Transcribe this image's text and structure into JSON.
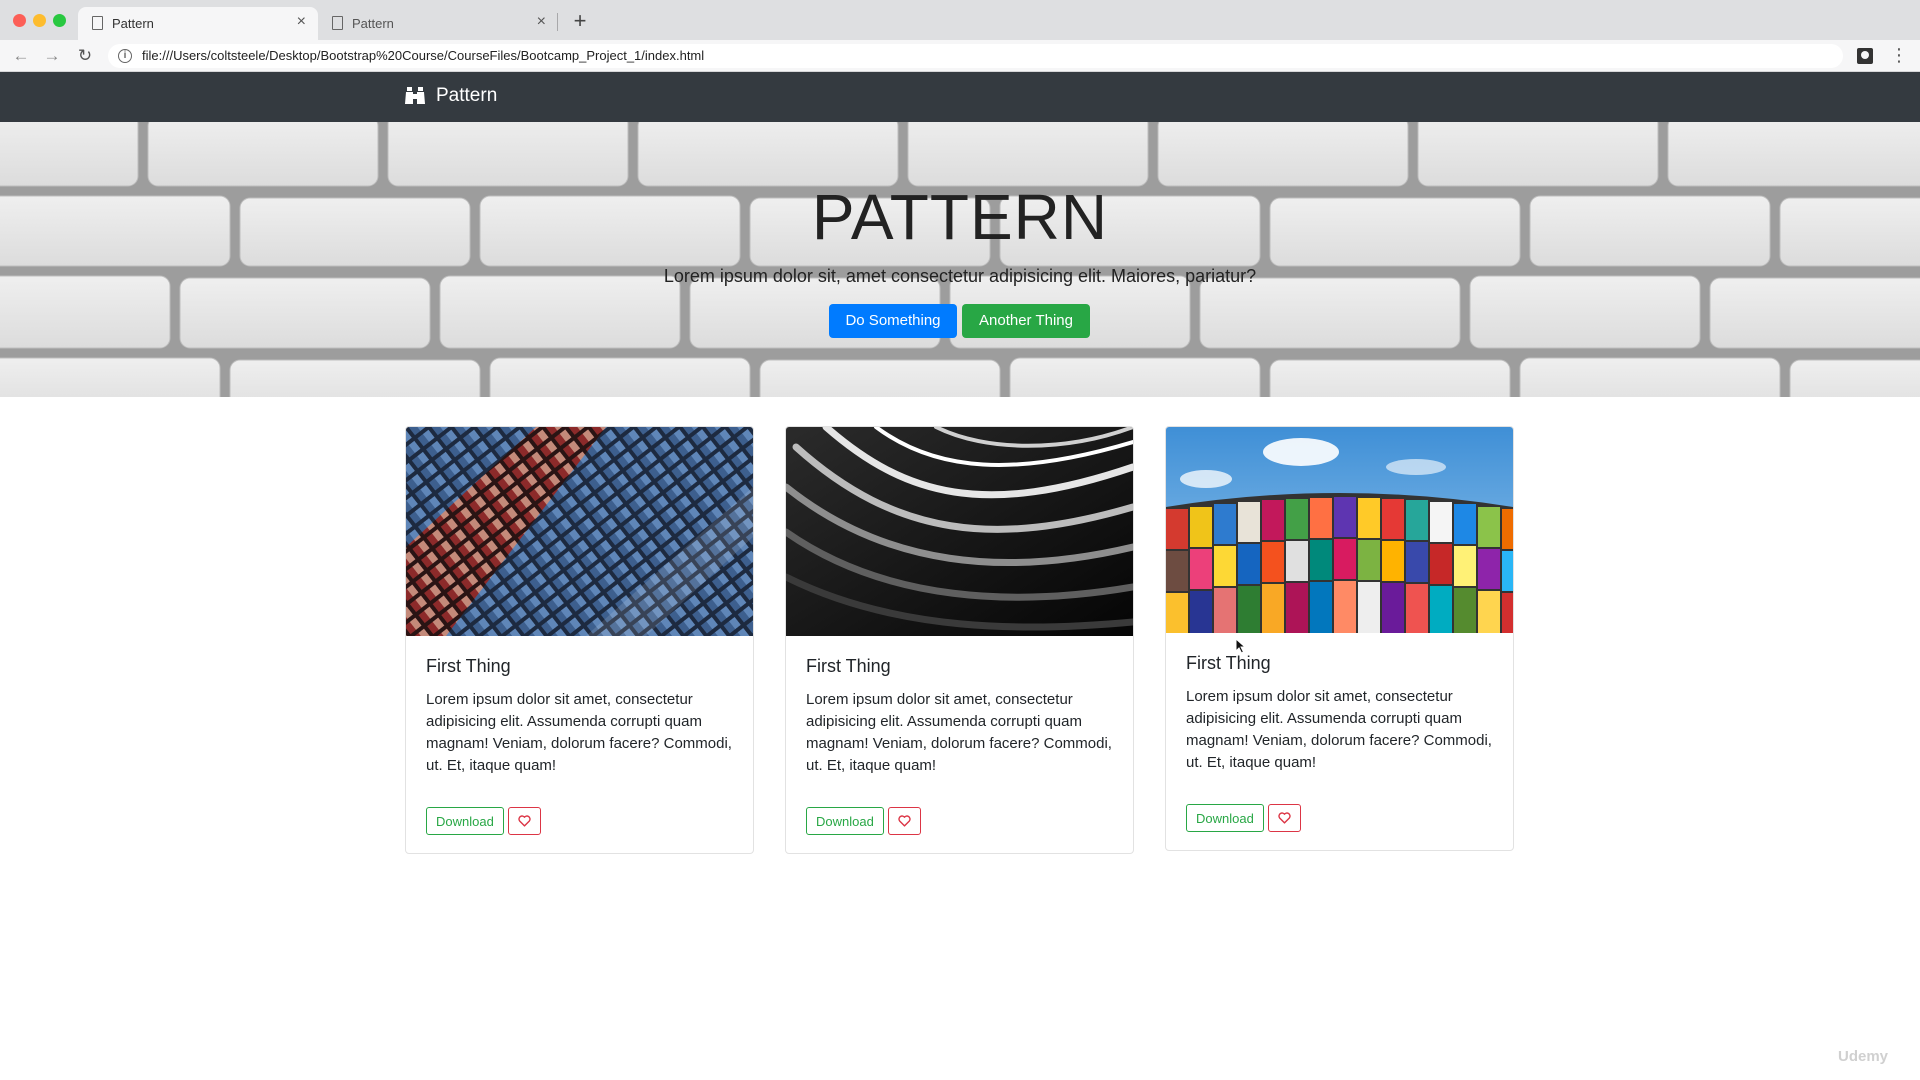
{
  "browser": {
    "tabs": [
      {
        "title": "Pattern",
        "active": true
      },
      {
        "title": "Pattern",
        "active": false
      }
    ],
    "tab_close_glyph": "×",
    "new_tab_glyph": "+",
    "url": "file:///Users/coltsteele/Desktop/Bootstrap%20Course/CourseFiles/Bootcamp_Project_1/index.html",
    "icons": {
      "back": "arrow-left-icon",
      "forward": "arrow-right-icon",
      "reload": "reload-icon",
      "info": "info-icon",
      "extension": "extension-icon",
      "menu": "kebab-menu-icon"
    }
  },
  "navbar": {
    "brand": "Pattern",
    "brand_icon": "binoculars-icon",
    "background": "#343a40"
  },
  "hero": {
    "title": "PATTERN",
    "lead": "Lorem ipsum dolor sit, amet consectetur adipisicing elit. Maiores, pariatur?",
    "primary_button": "Do Something",
    "secondary_button": "Another Thing",
    "colors": {
      "primary": "#007bff",
      "success": "#28a745"
    }
  },
  "cards": [
    {
      "title": "First Thing",
      "text": "Lorem ipsum dolor sit amet, consectetur adipisicing elit. Assumenda corrupti quam magnam! Veniam, dolorum facere? Commodi, ut. Et, itaque quam!",
      "download_label": "Download",
      "like_icon": "heart-icon"
    },
    {
      "title": "First Thing",
      "text": "Lorem ipsum dolor sit amet, consectetur adipisicing elit. Assumenda corrupti quam magnam! Veniam, dolorum facere? Commodi, ut. Et, itaque quam!",
      "download_label": "Download",
      "like_icon": "heart-icon"
    },
    {
      "title": "First Thing",
      "text": "Lorem ipsum dolor sit amet, consectetur adipisicing elit. Assumenda corrupti quam magnam! Veniam, dolorum facere? Commodi, ut. Et, itaque quam!",
      "download_label": "Download",
      "like_icon": "heart-icon"
    }
  ],
  "watermark": "Udemy"
}
